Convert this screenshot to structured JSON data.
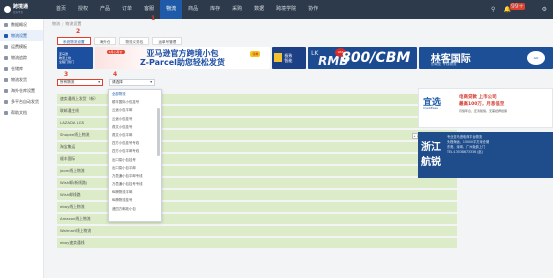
{
  "app": {
    "logo_title": "跨境通",
    "logo_sub": "官方平台"
  },
  "topnav": {
    "items": [
      "首页",
      "授权",
      "产品",
      "订单",
      "客服",
      "物流",
      "商品",
      "库存",
      "采购",
      "数据",
      "跨境学院",
      "协作"
    ],
    "active_index": 5,
    "badge": "99+"
  },
  "sidebar": {
    "items": [
      "数据概况",
      "物流设置",
      "运费模板",
      "物流追踪",
      "仓储库",
      "物流发货",
      "海外仓库设置",
      "多平台自动发货",
      "帮助文档"
    ]
  },
  "breadcrumb": [
    "物流",
    "物流设置"
  ],
  "tabs": [
    "系统物流设置",
    "海外仓",
    "物流义务包",
    "运单号管理"
  ],
  "banners": {
    "b1": [
      "亚马逊",
      "物流上线",
      "全程门到门"
    ],
    "b2_line1": "亚马逊官方跨境小包",
    "b2_line2": "Z-Parcel助您轻松发货",
    "b2_promo": "6月心有价",
    "b2_coupon": "领券",
    "b3": [
      "极致",
      "智能",
      "时效",
      "准确"
    ],
    "b4_lk": "LK",
    "b4_rmb": "RMB",
    "b4_price": "800/CBM",
    "b4_circle": "LRX",
    "b5_title": "林客国际",
    "b5_sub": "东南亚 专线物流",
    "b5_cta": "GO"
  },
  "filters": {
    "select1": "所有物流",
    "select2": "请选择"
  },
  "dropdown_items": [
    "全部物流",
    "顺丰国际小包挂号",
    "云途小包平邮",
    "云途小包挂号",
    "燕文小包挂号",
    "燕文小包平邮",
    "四方小包挂号专线",
    "四方小包平邮专线",
    "出口易小包挂号",
    "出口易小包平邮",
    "万邑通小包平邮专线",
    "万邑通小包挂号专线",
    "纵腾物流平邮",
    "纵腾物流挂号",
    "递四方邮政小包"
  ],
  "list_rows": [
    "速卖通线上发货（新）",
    "联邮通主线",
    "LAZADA LGS",
    "Shopee线上物流",
    "淘宝集运",
    "顺丰国际",
    "joom线上物流",
    "Wish邮(新线路)",
    "Wish邮线路",
    "ebay线上物流",
    "Amazon线上物流",
    "Walmart线上物流",
    "ebay速卖通线"
  ],
  "row_action": "+ 添加",
  "ad_right": {
    "brand": "宜选",
    "brand_sub": "CrediEase",
    "red1": "电商贷款 上市公司",
    "red2": "最高100万，月息低至",
    "grey": "月借年息，还清随借，无需抵押担保"
  },
  "ad_right2": {
    "t1": "浙江",
    "t2": "航锐",
    "lines": [
      "专业亚马逊电商平台物流",
      "头程海运、15000平方米仓储",
      "东莞、深圳、广州免费上门",
      "TEL:13538673336 (赵)"
    ]
  },
  "annotations": [
    "1",
    "2",
    "3",
    "4"
  ]
}
